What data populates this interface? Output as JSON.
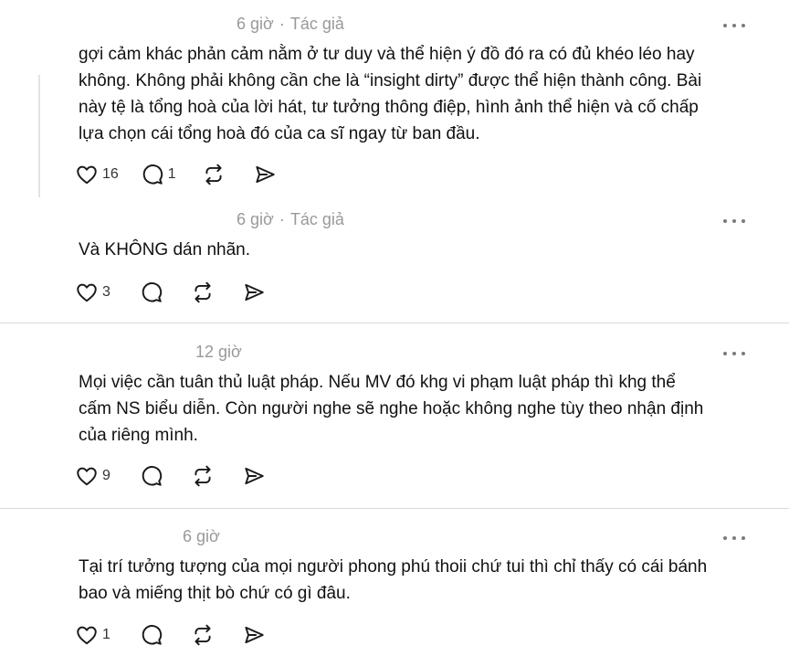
{
  "comments": [
    {
      "time": "6 giờ",
      "author_badge": "Tác giả",
      "lines": [
        "gợi cảm khác phản cảm nằm ở tư duy và thể hiện ý đồ đó ra có đủ khéo léo hay",
        "không. Không phải không cần che là “insight dirty” được thể hiện thành công. Bài",
        "này tệ là tổng hoà của lời hát, tư tưởng thông điệp, hình ảnh thể hiện và cố chấp",
        "lựa chọn cái tổng hoà đó của ca sĩ ngay từ ban đầu."
      ],
      "likes": "16",
      "replies": "1"
    },
    {
      "time": "6 giờ",
      "author_badge": "Tác giả",
      "lines": [
        "Và KHÔNG dán nhãn."
      ],
      "likes": "3",
      "replies": ""
    },
    {
      "time": "12 giờ",
      "author_badge": "",
      "lines": [
        "Mọi việc cần tuân thủ luật pháp. Nếu MV đó khg vi phạm luật pháp thì khg thể",
        "cấm NS biểu diễn. Còn người nghe sẽ nghe hoặc không nghe tùy theo nhận định",
        "của riêng mình."
      ],
      "likes": "9",
      "replies": ""
    },
    {
      "time": "6 giờ",
      "author_badge": "",
      "lines": [
        "Tại trí tưởng tượng của mọi người phong phú thoii chứ tui thì chỉ thấy có cái bánh",
        "bao và miếng thịt bò chứ có gì đâu."
      ],
      "likes": "1",
      "replies": ""
    }
  ],
  "icons": {
    "like": "heart-icon",
    "reply": "comment-bubble-icon",
    "repost": "repost-icon",
    "share": "send-icon",
    "more": "more-horizontal-icon"
  },
  "colors": {
    "text": "#111111",
    "meta": "#999999",
    "icon": "#1a1a1a",
    "divider": "#d9d9d9",
    "thread_line": "#e3e3e3"
  }
}
